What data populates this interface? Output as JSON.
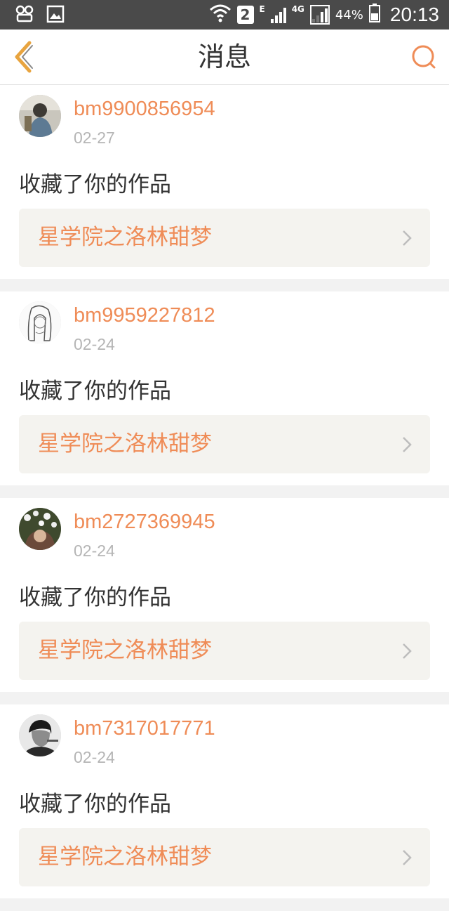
{
  "status_bar": {
    "sim_badge": "2",
    "network_e": "E",
    "network_4g": "4G",
    "battery": "44%",
    "time": "20:13"
  },
  "header": {
    "title": "消息",
    "back_icon": "chevron-left-icon",
    "search_icon": "search-icon",
    "accent": "#ef8c57"
  },
  "messages": [
    {
      "username": "bm9900856954",
      "date": "02-27",
      "action": "收藏了你的作品",
      "work_title": "星学院之洛林甜梦"
    },
    {
      "username": "bm9959227812",
      "date": "02-24",
      "action": "收藏了你的作品",
      "work_title": "星学院之洛林甜梦"
    },
    {
      "username": "bm2727369945",
      "date": "02-24",
      "action": "收藏了你的作品",
      "work_title": "星学院之洛林甜梦"
    },
    {
      "username": "bm7317017771",
      "date": "02-24",
      "action": "收藏了你的作品",
      "work_title": "星学院之洛林甜梦"
    }
  ]
}
